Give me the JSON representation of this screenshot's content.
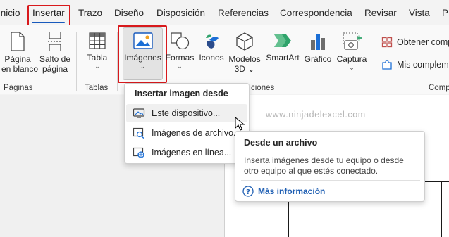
{
  "tabs": [
    {
      "id": "inicio",
      "label": "Inicio"
    },
    {
      "id": "insertar",
      "label": "Insertar"
    },
    {
      "id": "trazo",
      "label": "Trazo"
    },
    {
      "id": "diseno",
      "label": "Diseño"
    },
    {
      "id": "disposicion",
      "label": "Disposición"
    },
    {
      "id": "referencias",
      "label": "Referencias"
    },
    {
      "id": "correspondencia",
      "label": "Correspondencia"
    },
    {
      "id": "revisar",
      "label": "Revisar"
    },
    {
      "id": "vista",
      "label": "Vista"
    },
    {
      "id": "partial",
      "label": "P"
    }
  ],
  "active_tab": "Insertar",
  "ribbon": {
    "pagina_en_blanco": {
      "line1": "Página",
      "line2": "en blanco"
    },
    "salto_de_pagina": {
      "line1": "Salto de",
      "line2": "página"
    },
    "tabla": {
      "label": "Tabla"
    },
    "imagenes": {
      "label": "Imágenes"
    },
    "formas": {
      "label": "Formas"
    },
    "iconos": {
      "label": "Iconos"
    },
    "modelos_3d": {
      "line1": "Modelos",
      "line2": "3D"
    },
    "smartart": {
      "label": "SmartArt"
    },
    "grafico": {
      "label": "Gráfico"
    },
    "captura": {
      "label": "Captura"
    },
    "obtener_complementos": "Obtener comp",
    "mis_complementos": "Mis compleme",
    "groups": {
      "paginas": "Páginas",
      "tablas": "Tablas",
      "ilustraciones": "ciones",
      "complementos": "Comp"
    }
  },
  "dropdown": {
    "title": "Insertar imagen desde",
    "items": [
      {
        "label": "Este dispositivo..."
      },
      {
        "label": "Imágenes de archivo..."
      },
      {
        "label": "Imágenes en línea..."
      }
    ]
  },
  "tooltip": {
    "title": "Desde un archivo",
    "body": "Inserta imágenes desde tu equipo o desde otro equipo al que estés conectado.",
    "link": "Más información"
  },
  "watermark": "www.ninjadelexcel.com",
  "colors": {
    "accent": "#185abd",
    "highlight_border": "#d8191c",
    "link": "#1f5fb3"
  }
}
